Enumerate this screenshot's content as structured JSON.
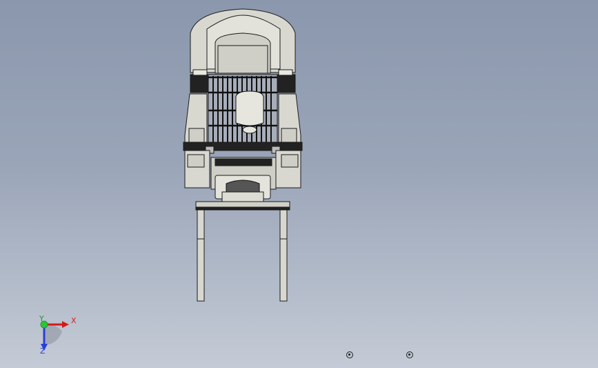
{
  "viewport": {
    "background_top": "#8b97ad",
    "background_bottom": "#c4cbd6"
  },
  "model": {
    "icon": "forklift-cad-model-icon",
    "body_color": "#d8d8d0",
    "dark_color": "#222222",
    "line_color": "#1a1a1a"
  },
  "triad": {
    "x_label": "X",
    "y_label": "Y",
    "z_label": "Z",
    "x_color": "#d41a1a",
    "y_color": "#1f9a2a",
    "z_color": "#2a3ed6"
  },
  "view_controls": {
    "button_icon": "rotate-center-icon"
  }
}
